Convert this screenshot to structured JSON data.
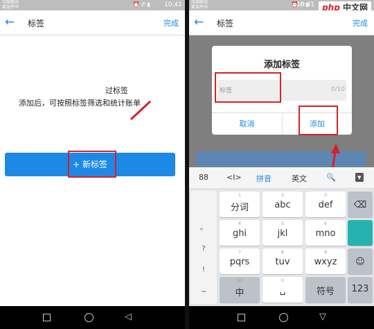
{
  "left": {
    "status": {
      "carrier_line1": "中国移动",
      "carrier_line2": "紧急呼叫",
      "time": "10:41"
    },
    "header": {
      "back_icon": "←",
      "title": "标签",
      "done": "完成"
    },
    "hint_line1": "过标签",
    "hint_line2": "添加后，可按照标签筛选和统计账单",
    "add_button": "+ 新标签",
    "nav": {
      "back": "◁"
    }
  },
  "right": {
    "status": {
      "carrier_line1": "中国移动",
      "carrier_line2": "紧急呼叫",
      "time": "10:41"
    },
    "header": {
      "back_icon": "←",
      "title": "标签",
      "done": "完成"
    },
    "dialog": {
      "title": "添加标签",
      "placeholder": "标签",
      "counter": "0/10",
      "cancel": "取消",
      "add": "添加"
    },
    "keyboard": {
      "toolbar": [
        "88",
        "<I>",
        "拼音",
        "英文",
        "🔍",
        "▾"
      ],
      "side": [
        "。",
        "?",
        "!",
        "~"
      ],
      "keys": {
        "r1": [
          {
            "sub": "1",
            "main": "分词"
          },
          {
            "sub": "2",
            "main": "abc"
          },
          {
            "sub": "3",
            "main": "def"
          }
        ],
        "r2": [
          {
            "sub": "4",
            "main": "ghi"
          },
          {
            "sub": "5",
            "main": "jkl"
          },
          {
            "sub": "6",
            "main": "mno"
          }
        ],
        "r3": [
          {
            "sub": "7",
            "main": "pqrs"
          },
          {
            "sub": "8",
            "main": "tuv"
          },
          {
            "sub": "9",
            "main": "wxyz"
          }
        ],
        "r4": [
          {
            "sub": "En",
            "main": "中"
          },
          {
            "sub": "0",
            "main": "␣"
          },
          {
            "sub": "",
            "main": "符号"
          }
        ],
        "backspace": "⌫",
        "num": "123",
        "emoji": "☺"
      }
    },
    "nav": {
      "back": "▽"
    }
  },
  "watermark": {
    "part1": "php",
    "part2": " 中文网"
  }
}
